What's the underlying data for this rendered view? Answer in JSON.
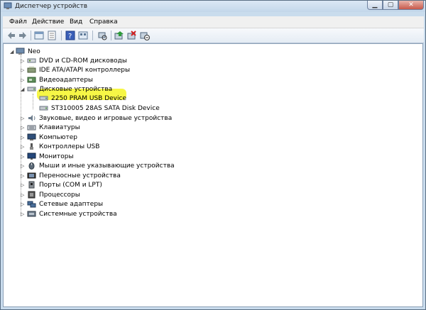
{
  "window": {
    "title": "Диспетчер устройств"
  },
  "menu": [
    "Файл",
    "Действие",
    "Вид",
    "Справка"
  ],
  "toolbar": [
    "back-icon",
    "forward-icon",
    "up-icon",
    "properties-icon",
    "help-icon",
    "view-icon",
    "scan-icon",
    "update-driver-icon",
    "uninstall-icon",
    "disable-icon"
  ],
  "tree": {
    "root": "Neo",
    "categories": [
      {
        "label": "DVD и CD-ROM дисководы",
        "icon": "dvd-drive-icon"
      },
      {
        "label": "IDE ATA/ATAPI контроллеры",
        "icon": "ide-controller-icon"
      },
      {
        "label": "Видеоадаптеры",
        "icon": "display-adapter-icon"
      },
      {
        "label": "Дисковые устройства",
        "icon": "disk-drive-icon",
        "expanded": true,
        "children": [
          "2250 PRAM USB Device",
          "ST310005 28AS SATA Disk Device"
        ]
      },
      {
        "label": "Звуковые, видео и игровые устройства",
        "icon": "sound-icon"
      },
      {
        "label": "Клавиатуры",
        "icon": "keyboard-icon"
      },
      {
        "label": "Компьютер",
        "icon": "computer-icon"
      },
      {
        "label": "Контроллеры USB",
        "icon": "usb-icon"
      },
      {
        "label": "Мониторы",
        "icon": "monitor-icon"
      },
      {
        "label": "Мыши и иные указывающие устройства",
        "icon": "mouse-icon"
      },
      {
        "label": "Переносные устройства",
        "icon": "portable-device-icon"
      },
      {
        "label": "Порты (COM и LPT)",
        "icon": "port-icon"
      },
      {
        "label": "Процессоры",
        "icon": "processor-icon"
      },
      {
        "label": "Сетевые адаптеры",
        "icon": "network-adapter-icon"
      },
      {
        "label": "Системные устройства",
        "icon": "system-device-icon"
      }
    ]
  },
  "colors": {
    "highlight": "#f5f526",
    "titlebar": "#c9dced"
  }
}
